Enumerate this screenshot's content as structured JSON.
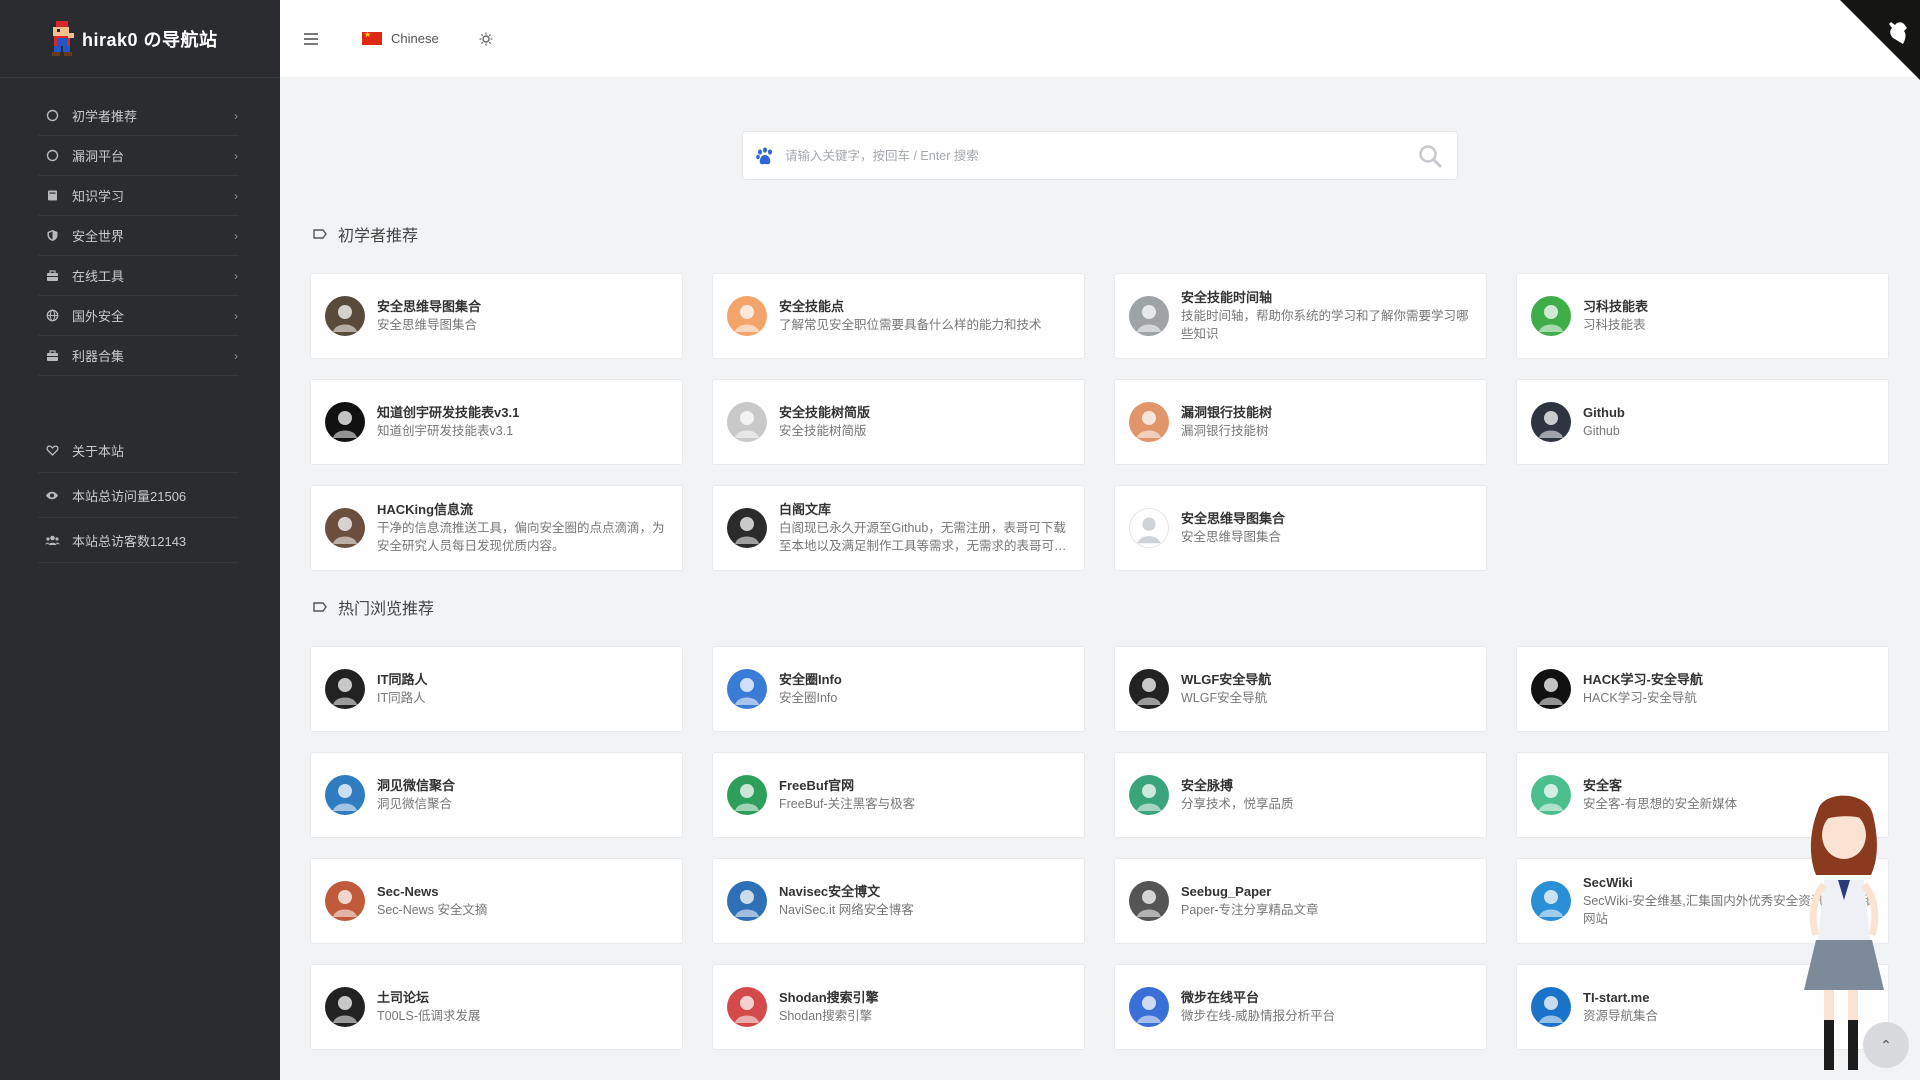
{
  "brand": {
    "name": "hirak0 の导航站"
  },
  "nav": [
    {
      "label": "初学者推荐",
      "icon": "circle-icon"
    },
    {
      "label": "漏洞平台",
      "icon": "circle-icon"
    },
    {
      "label": "知识学习",
      "icon": "book-icon"
    },
    {
      "label": "安全世界",
      "icon": "shield-icon"
    },
    {
      "label": "在线工具",
      "icon": "toolbox-icon"
    },
    {
      "label": "国外安全",
      "icon": "globe-icon"
    },
    {
      "label": "利器合集",
      "icon": "toolbox-icon"
    }
  ],
  "nav_extra": [
    {
      "label": "关于本站",
      "icon": "heart-icon"
    },
    {
      "label": "本站总访问量21506",
      "icon": "eye-icon"
    },
    {
      "label": "本站总访客数12143",
      "icon": "users-icon"
    }
  ],
  "topbar": {
    "language": "Chinese"
  },
  "search": {
    "placeholder": "请输入关键字，按回车 / Enter 搜索"
  },
  "sections": [
    {
      "title": "初学者推荐",
      "cards": [
        {
          "title": "安全思维导图集合",
          "desc": "安全思维导图集合",
          "icon_color": "#5a4a3a"
        },
        {
          "title": "安全技能点",
          "desc": "了解常见安全职位需要具备什么样的能力和技术",
          "icon_color": "#f3a46b"
        },
        {
          "title": "安全技能时间轴",
          "desc": "技能时间轴，帮助你系统的学习和了解你需要学习哪些知识",
          "icon_color": "#9ea3a6"
        },
        {
          "title": "习科技能表",
          "desc": "习科技能表",
          "icon_color": "#3fae49"
        },
        {
          "title": "知道创宇研发技能表v3.1",
          "desc": "知道创宇研发技能表v3.1",
          "icon_color": "#111111"
        },
        {
          "title": "安全技能树简版",
          "desc": "安全技能树简版",
          "icon_color": "#c9c9c9"
        },
        {
          "title": "漏洞银行技能树",
          "desc": "漏洞银行技能树",
          "icon_color": "#e0956b"
        },
        {
          "title": "Github",
          "desc": "Github",
          "icon_color": "#2e3440"
        },
        {
          "title": "HACKing信息流",
          "desc": "干净的信息流推送工具，偏向安全圈的点点滴滴，为安全研究人员每日发现优质内容。",
          "icon_color": "#6b4e3d"
        },
        {
          "title": "白阁文库",
          "desc": "白阁现已永久开源至Github，无需注册，表哥可下载至本地以及满足制作工具等需求，无需求的表哥可直接在线使用",
          "icon_color": "#2b2b2b"
        },
        {
          "title": "安全思维导图集合",
          "desc": "安全思维导图集合",
          "icon_color": "#ffffff"
        }
      ]
    },
    {
      "title": "热门浏览推荐",
      "cards": [
        {
          "title": "IT同路人",
          "desc": "IT同路人",
          "icon_color": "#222222"
        },
        {
          "title": "安全圈Info",
          "desc": "安全圈Info",
          "icon_color": "#3a7bd5"
        },
        {
          "title": "WLGF安全导航",
          "desc": "WLGF安全导航",
          "icon_color": "#222222"
        },
        {
          "title": "HACK学习-安全导航",
          "desc": "HACK学习-安全导航",
          "icon_color": "#111111"
        },
        {
          "title": "洞见微信聚合",
          "desc": "洞见微信聚合",
          "icon_color": "#2f7cc1"
        },
        {
          "title": "FreeBuf官网",
          "desc": "FreeBuf-关注黑客与极客",
          "icon_color": "#2e9e5b"
        },
        {
          "title": "安全脉搏",
          "desc": "分享技术，悦享品质",
          "icon_color": "#3aa57a"
        },
        {
          "title": "安全客",
          "desc": "安全客-有思想的安全新媒体",
          "icon_color": "#4cbf8e"
        },
        {
          "title": "Sec-News",
          "desc": "Sec-News 安全文摘",
          "icon_color": "#c05a3a"
        },
        {
          "title": "Navisec安全博文",
          "desc": "NaviSec.it 网络安全博客",
          "icon_color": "#2f6fb5"
        },
        {
          "title": "Seebug_Paper",
          "desc": "Paper-专注分享精品文章",
          "icon_color": "#555555"
        },
        {
          "title": "SecWiki",
          "desc": "SecWiki-安全维基,汇集国内外优秀安全资讯、工具和网站",
          "icon_color": "#2a8fd6"
        },
        {
          "title": "土司论坛",
          "desc": "T00LS-低调求发展",
          "icon_color": "#222222"
        },
        {
          "title": "Shodan搜索引擎",
          "desc": "Shodan搜索引擎",
          "icon_color": "#d44a4a"
        },
        {
          "title": "微步在线平台",
          "desc": "微步在线-威胁情报分析平台",
          "icon_color": "#3b6fd8"
        },
        {
          "title": "TI-start.me",
          "desc": "资源导航集合",
          "icon_color": "#1a73c8"
        }
      ]
    }
  ]
}
